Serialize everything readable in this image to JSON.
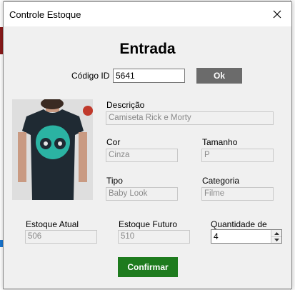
{
  "window": {
    "title": "Controle Estoque"
  },
  "heading": "Entrada",
  "codigo": {
    "label": "Código ID",
    "value": "5641",
    "button": "Ok"
  },
  "product": {
    "descricao": {
      "label": "Descrição",
      "value": "Camiseta Rick e Morty"
    },
    "cor": {
      "label": "Cor",
      "value": "Cinza"
    },
    "tamanho": {
      "label": "Tamanho",
      "value": "P"
    },
    "tipo": {
      "label": "Tipo",
      "value": "Baby Look"
    },
    "categoria": {
      "label": "Categoria",
      "value": "Filme"
    }
  },
  "stock": {
    "atual": {
      "label": "Estoque Atual",
      "value": "506"
    },
    "futuro": {
      "label": "Estoque Futuro",
      "value": "510"
    },
    "quantidade": {
      "label": "Quantidade de Entrada",
      "value": "4"
    }
  },
  "confirm_label": "Confirmar",
  "icons": {
    "close": "close-icon",
    "spin_up": "chevron-up-icon",
    "spin_down": "chevron-down-icon"
  },
  "colors": {
    "ok_button": "#6b6b6b",
    "confirm_button": "#1e7b1e",
    "shirt": "#1f2a33",
    "print": "#2bb3a3"
  }
}
